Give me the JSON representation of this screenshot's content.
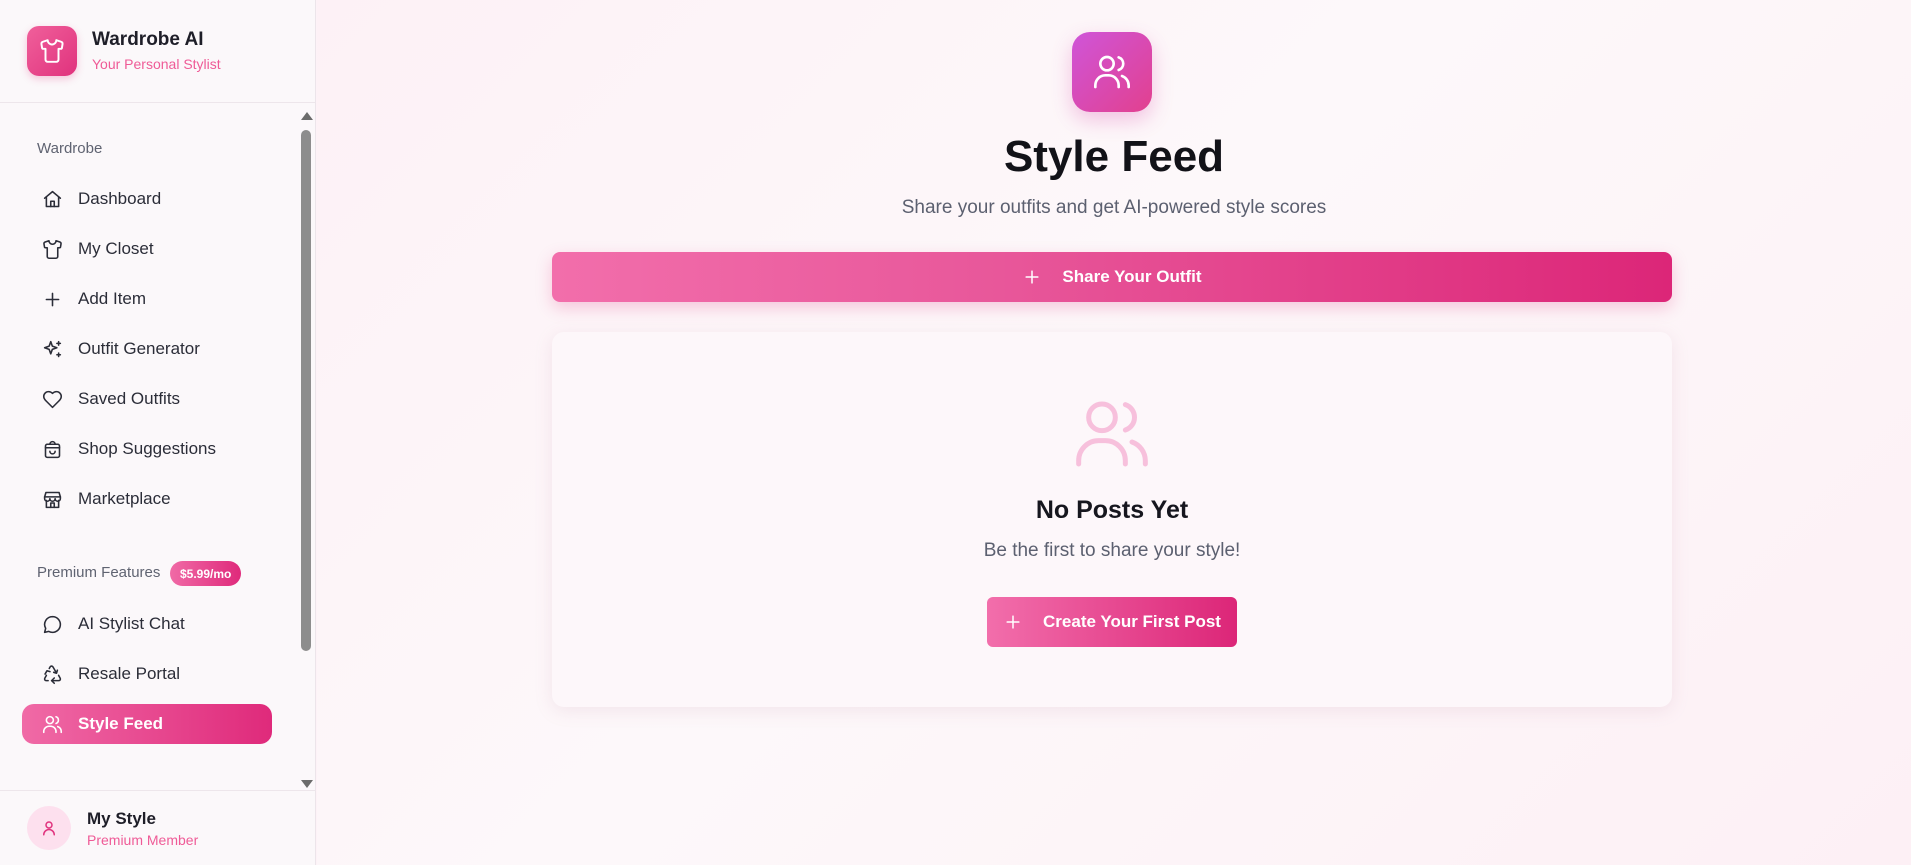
{
  "brand": {
    "title": "Wardrobe AI",
    "subtitle": "Your Personal Stylist",
    "logo_icon": "shirt-icon"
  },
  "sidebar": {
    "wardrobe_section": "Wardrobe",
    "wardrobe_items": [
      {
        "label": "Dashboard",
        "icon": "home-icon"
      },
      {
        "label": "My Closet",
        "icon": "shirt-icon"
      },
      {
        "label": "Add Item",
        "icon": "plus-icon"
      },
      {
        "label": "Outfit Generator",
        "icon": "sparkles-icon"
      },
      {
        "label": "Saved Outfits",
        "icon": "heart-icon"
      },
      {
        "label": "Shop Suggestions",
        "icon": "shopping-bag-icon"
      },
      {
        "label": "Marketplace",
        "icon": "store-icon"
      }
    ],
    "premium_section": "Premium Features",
    "premium_badge": "$5.99/mo",
    "premium_items": [
      {
        "label": "AI Stylist Chat",
        "icon": "chat-icon"
      },
      {
        "label": "Resale Portal",
        "icon": "recycle-icon"
      },
      {
        "label": "Style Feed",
        "icon": "users-icon",
        "active": true
      }
    ]
  },
  "user": {
    "name": "My Style",
    "role": "Premium Member",
    "avatar_icon": "user-icon"
  },
  "main": {
    "hero_icon": "users-icon",
    "title": "Style Feed",
    "subtitle": "Share your outfits and get AI-powered style scores",
    "share_button": "Share Your Outfit",
    "empty_state": {
      "icon": "users-icon",
      "title": "No Posts Yet",
      "subtitle": "Be the first to share your style!",
      "button": "Create Your First Post"
    }
  },
  "colors": {
    "accent_start": "#f06aa6",
    "accent_end": "#df2a7b",
    "hero_start": "#cf55d9",
    "hero_end": "#e2408e",
    "brand_pink": "#ef5b97"
  }
}
